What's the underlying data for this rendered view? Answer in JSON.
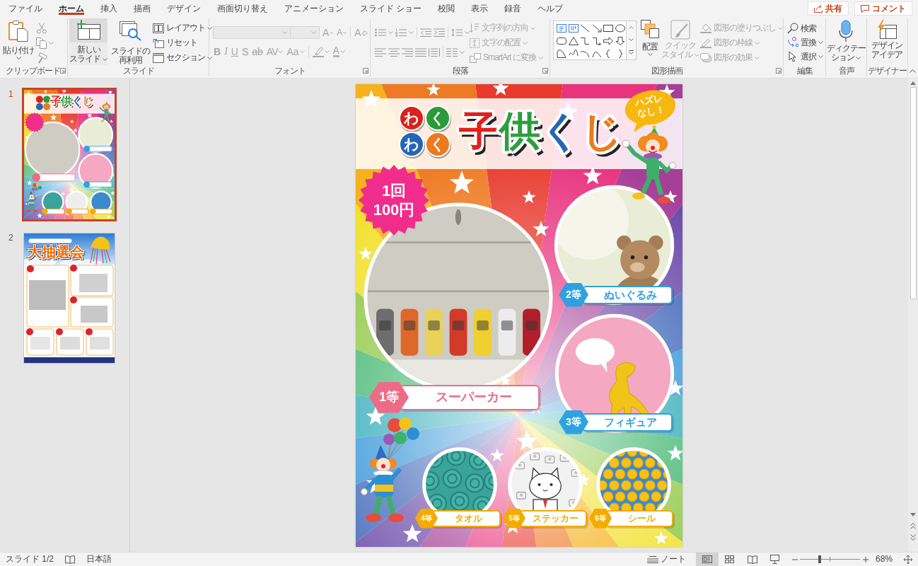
{
  "tabs": [
    {
      "label": "ファイル",
      "selected": false
    },
    {
      "label": "ホーム",
      "selected": true
    },
    {
      "label": "挿入",
      "selected": false
    },
    {
      "label": "描画",
      "selected": false
    },
    {
      "label": "デザイン",
      "selected": false
    },
    {
      "label": "画面切り替え",
      "selected": false
    },
    {
      "label": "アニメーション",
      "selected": false
    },
    {
      "label": "スライド ショー",
      "selected": false
    },
    {
      "label": "校閲",
      "selected": false
    },
    {
      "label": "表示",
      "selected": false
    },
    {
      "label": "録音",
      "selected": false
    },
    {
      "label": "ヘルプ",
      "selected": false
    }
  ],
  "header_buttons": [
    {
      "kind": "share",
      "label": "共有"
    },
    {
      "kind": "comment",
      "label": "コメント"
    }
  ],
  "ribbon": {
    "clipboard": {
      "label": "クリップボード",
      "paste": {
        "label": "貼り付け",
        "dropdown": true
      }
    },
    "slides": {
      "label": "スライド",
      "new_slide": {
        "lines": [
          "新しい",
          "スライド"
        ],
        "dropdown": true,
        "hovered": true
      },
      "reuse": {
        "lines": [
          "スライドの",
          "再利用"
        ]
      },
      "commands": [
        {
          "label": "レイアウト",
          "dropdown": true
        },
        {
          "label": "リセット",
          "dropdown": false
        },
        {
          "label": "セクション",
          "dropdown": true
        }
      ]
    },
    "font": {
      "label": "フォント",
      "name_field": {
        "disabled": true
      },
      "size_field": {
        "disabled": true
      },
      "row1": [
        {
          "kind": "grow",
          "label": "A",
          "disabled": true
        },
        {
          "kind": "shrink",
          "label": "A",
          "disabled": true
        },
        {
          "kind": "clear",
          "label": "A",
          "disabled": true
        }
      ],
      "row2": [
        {
          "kind": "bold",
          "label": "B",
          "disabled": true
        },
        {
          "kind": "italic",
          "label": "I",
          "disabled": true
        },
        {
          "kind": "underline",
          "label": "U",
          "disabled": true
        },
        {
          "kind": "shadow",
          "label": "S",
          "disabled": true
        },
        {
          "kind": "strike",
          "label": "ab",
          "disabled": true
        },
        {
          "kind": "spacing",
          "label": "AV",
          "disabled": true
        },
        {
          "kind": "case",
          "label": "Aa",
          "disabled": true
        },
        {
          "kind": "highlight",
          "disabled": true
        },
        {
          "kind": "color",
          "label": "A",
          "disabled": true
        }
      ]
    },
    "paragraph": {
      "label": "段落",
      "commands": [
        {
          "label": "文字列の方向",
          "disabled": true
        },
        {
          "label": "文字の配置",
          "disabled": true
        },
        {
          "label": "SmartArt に変換",
          "disabled": true
        }
      ]
    },
    "drawing": {
      "label": "図形描画",
      "arrange": {
        "label": "配置"
      },
      "quick_styles": {
        "lines": [
          "クイック",
          "スタイル"
        ],
        "disabled": true
      },
      "commands": [
        {
          "label": "図形の塗りつぶし",
          "disabled": true
        },
        {
          "label": "図形の枠線",
          "disabled": true
        },
        {
          "label": "図形の効果",
          "disabled": true
        }
      ]
    },
    "editing": {
      "label": "編集",
      "commands": [
        {
          "label": "検索",
          "dropdown": false
        },
        {
          "label": "置換",
          "dropdown": true
        },
        {
          "label": "選択",
          "dropdown": true
        }
      ]
    },
    "voice": {
      "label": "音声",
      "dictation": {
        "lines": [
          "ディクテー",
          "ション"
        ]
      }
    },
    "designer": {
      "label": "デザイナー",
      "design_ideas": {
        "lines": [
          "デザイン",
          "アイデア"
        ]
      }
    }
  },
  "slide_thumbnails": [
    {
      "number": "1",
      "selected": true,
      "kind": "rainbow",
      "title": "子供くじ"
    },
    {
      "number": "2",
      "selected": false,
      "kind": "sky",
      "title": "大抽選会"
    }
  ],
  "slide": {
    "logo_letters": [
      {
        "text": "わ",
        "color": "#d8221d"
      },
      {
        "text": "く",
        "color": "#2a9b3b"
      },
      {
        "text": "わ",
        "color": "#2566b4"
      },
      {
        "text": "く",
        "color": "#ec7a1f"
      }
    ],
    "title": "子供くじ",
    "bubble": {
      "lines": [
        "ハズレ",
        "なし！"
      ]
    },
    "price": {
      "lines": [
        "1回",
        "100円"
      ]
    },
    "prizes": [
      {
        "rank": "1等",
        "name": "スーパーカー",
        "color": "#ee6b88"
      },
      {
        "rank": "2等",
        "name": "ぬいぐるみ",
        "color": "#2ea2e0"
      },
      {
        "rank": "3等",
        "name": "フィギュア",
        "color": "#2ea2e0"
      },
      {
        "rank": "4等",
        "name": "タオル",
        "color": "#f2ac00"
      },
      {
        "rank": "5等",
        "name": "ステッカー",
        "color": "#f2ac00"
      },
      {
        "rank": "6等",
        "name": "シール",
        "color": "#f2ac00"
      }
    ]
  },
  "status_bar": {
    "slide_indicator": "スライド 1/2",
    "language": "日本語",
    "notes": "ノート",
    "views": [
      {
        "selected": true
      },
      {
        "selected": false
      },
      {
        "selected": false
      },
      {
        "selected": false
      }
    ],
    "zoom": {
      "level": 0.33,
      "reading": "68%"
    }
  }
}
